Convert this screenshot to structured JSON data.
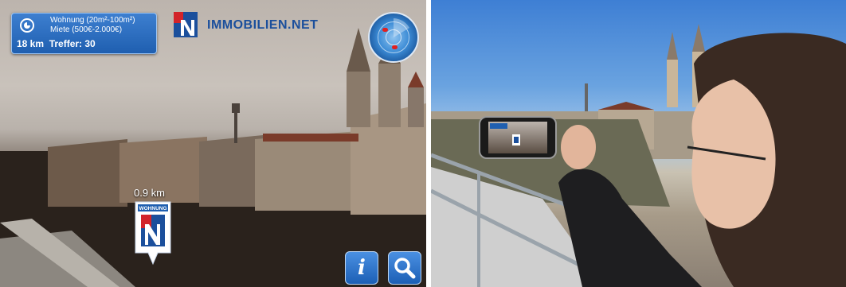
{
  "ar_screen": {
    "filter_box": {
      "line1": "Wohnung (20m²-100m²)",
      "line2": "Miete (500€-2.000€)",
      "radius": "18 km",
      "hits": "Treffer: 30"
    },
    "brand": "IMMOBILIEN.NET",
    "marker": {
      "distance": "0.9 km",
      "label": "WOHNUNG"
    },
    "buttons": {
      "info_icon": "info-icon",
      "search_icon": "search-icon",
      "info_glyph": "i"
    },
    "colors": {
      "accent_blue": "#1f5fb0",
      "brand_red": "#d2232a",
      "brand_blue": "#1b4f9c"
    }
  },
  "photo": {
    "phone_screen": {
      "marker_label": "WOHNUNG"
    }
  }
}
